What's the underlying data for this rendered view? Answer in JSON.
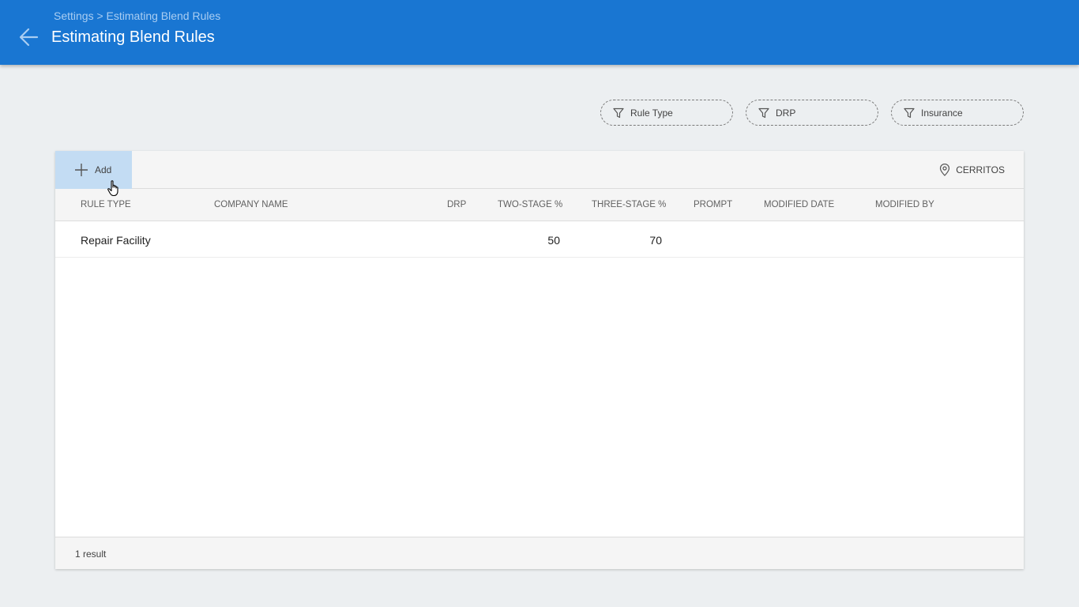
{
  "header": {
    "breadcrumb": "Settings > Estimating Blend Rules",
    "title": "Estimating Blend Rules",
    "back_icon": "arrow-left-icon"
  },
  "filters": [
    {
      "label": "Rule Type",
      "icon": "filter-icon"
    },
    {
      "label": "DRP",
      "icon": "filter-icon"
    },
    {
      "label": "Insurance",
      "icon": "filter-icon"
    }
  ],
  "toolbar": {
    "add_label": "Add",
    "location_label": "CERRITOS"
  },
  "table": {
    "columns": [
      "RULE TYPE",
      "COMPANY NAME",
      "DRP",
      "TWO-STAGE %",
      "THREE-STAGE %",
      "PROMPT",
      "MODIFIED DATE",
      "MODIFIED BY"
    ],
    "rows": [
      {
        "rule_type": "Repair Facility",
        "company_name": "",
        "drp": "",
        "two_stage": "50",
        "three_stage": "70",
        "prompt": "",
        "modified_date": "",
        "modified_by": ""
      }
    ]
  },
  "footer": {
    "result_count": "1 result"
  },
  "colors": {
    "appbar": "#1976d2",
    "add_highlight": "#c3dcf3",
    "background": "#eceff1"
  }
}
